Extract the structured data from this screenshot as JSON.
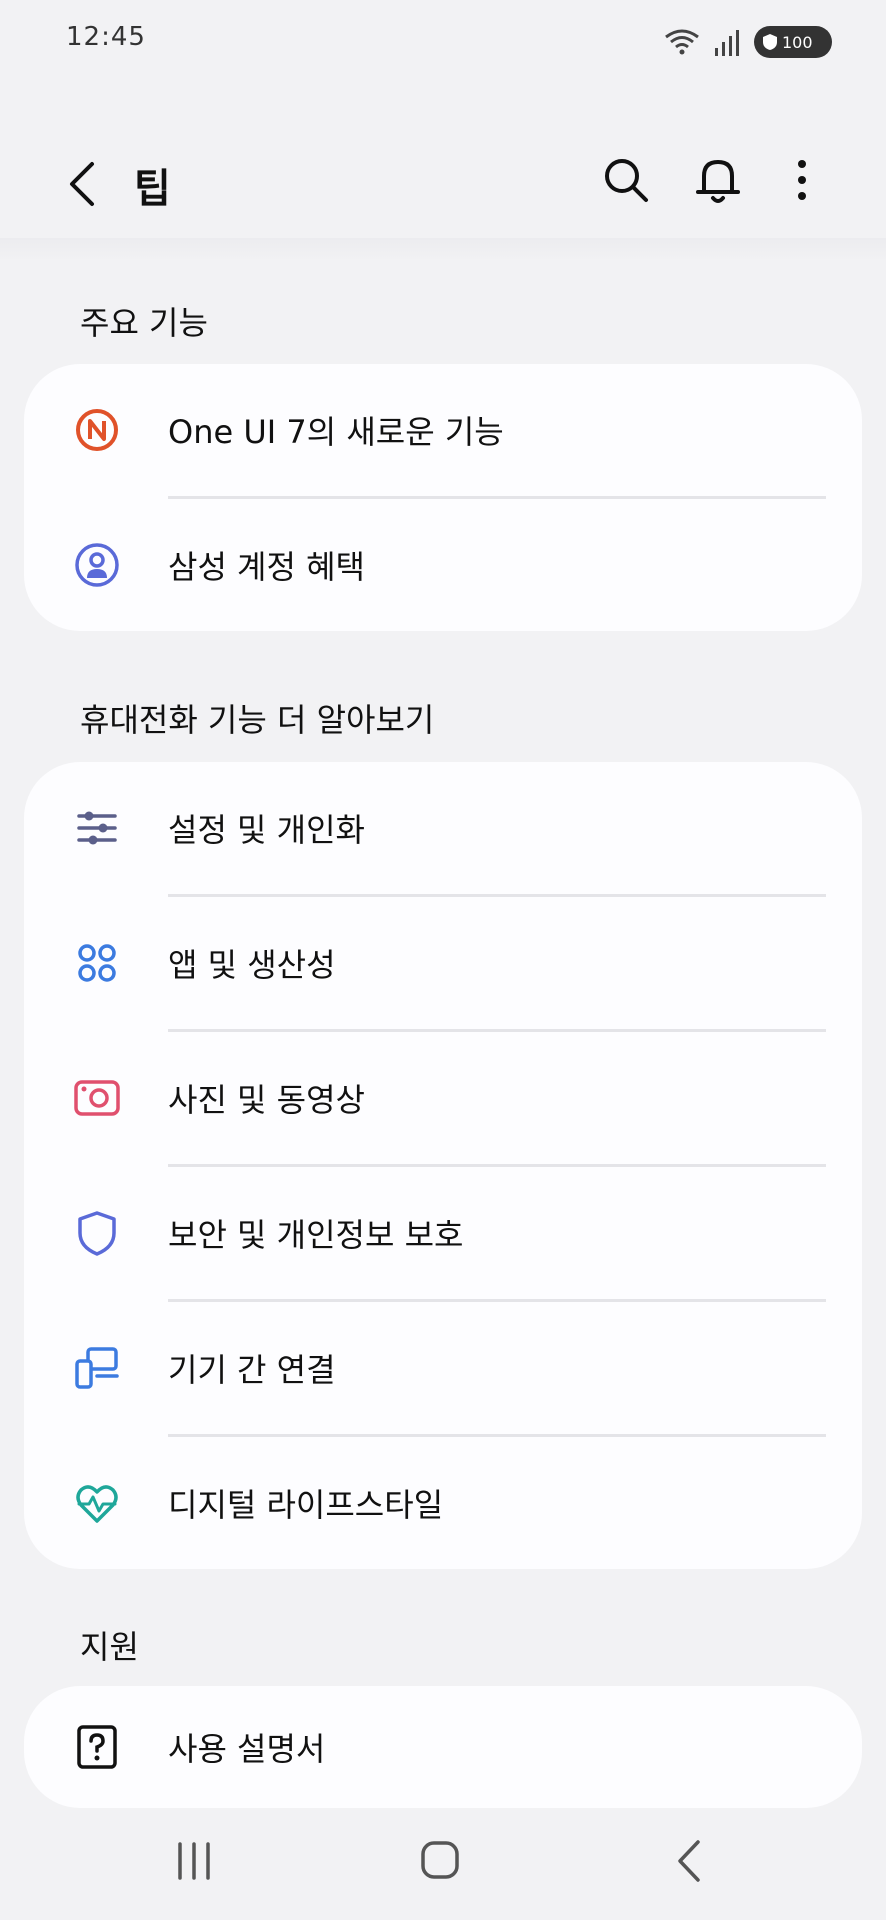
{
  "status": {
    "time": "12:45",
    "battery": "100"
  },
  "header": {
    "title": "팁"
  },
  "sections": {
    "key_features": {
      "title": "주요 기능",
      "items": [
        {
          "label": "One UI 7의 새로운 기능",
          "icon": "one-ui-badge-icon",
          "color": "#e0522a"
        },
        {
          "label": "삼성 계정 혜택",
          "icon": "account-icon",
          "color": "#5a6ad8"
        }
      ]
    },
    "learn_more": {
      "title": "휴대전화 기능 더 알아보기",
      "items": [
        {
          "label": "설정 및 개인화",
          "icon": "sliders-icon",
          "color": "#5b5f8a"
        },
        {
          "label": "앱 및 생산성",
          "icon": "apps-grid-icon",
          "color": "#3c7be0"
        },
        {
          "label": "사진 및 동영상",
          "icon": "camera-icon",
          "color": "#e0506e"
        },
        {
          "label": "보안 및 개인정보 보호",
          "icon": "shield-icon",
          "color": "#5a6ad8"
        },
        {
          "label": "기기 간 연결",
          "icon": "devices-icon",
          "color": "#3c7be0"
        },
        {
          "label": "디지털 라이프스타일",
          "icon": "heart-pulse-icon",
          "color": "#1fa79a"
        }
      ]
    },
    "support": {
      "title": "지원",
      "items": [
        {
          "label": "사용 설명서",
          "icon": "help-icon",
          "color": "#111111"
        }
      ]
    }
  }
}
